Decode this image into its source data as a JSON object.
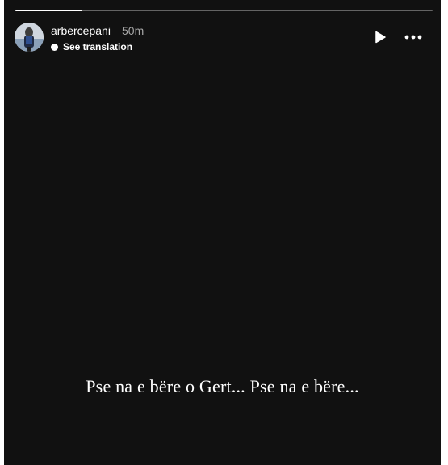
{
  "story": {
    "progress": 0.16,
    "username": "arbercepani",
    "time_ago": "50m",
    "see_translation": "See translation",
    "caption": "Pse na e bëre o Gert... Pse na e bëre...",
    "avatar_icon": "profile-photo",
    "play_icon": "play-icon",
    "more_icon": "more-icon"
  },
  "colors": {
    "background": "#111111",
    "text": "#ffffff",
    "muted_text": "#a8a8a8",
    "page_background": "#ffffff"
  }
}
